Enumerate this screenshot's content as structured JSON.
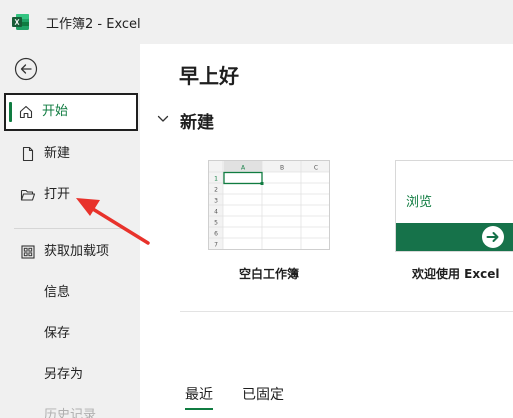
{
  "window": {
    "title": "工作簿2  -  Excel",
    "app_icon": "excel-icon"
  },
  "sidebar": {
    "back_icon": "back-arrow-icon",
    "items": [
      {
        "label": "开始",
        "icon": "home-icon",
        "active": true
      },
      {
        "label": "新建",
        "icon": "new-document-icon"
      },
      {
        "label": "打开",
        "icon": "open-folder-icon"
      },
      {
        "label": "获取加载项",
        "icon": "add-ins-icon"
      },
      {
        "label": "信息"
      },
      {
        "label": "保存"
      },
      {
        "label": "另存为"
      },
      {
        "label": "历史记录"
      }
    ]
  },
  "main": {
    "greeting": "早上好",
    "new_section": {
      "title": "新建",
      "templates": [
        {
          "label": "空白工作簿",
          "grid_columns": [
            "A",
            "B",
            "C"
          ],
          "grid_rows": [
            "1",
            "2",
            "3",
            "4",
            "5",
            "6",
            "7"
          ]
        },
        {
          "label": "欢迎使用 Excel",
          "link_text": "浏览"
        }
      ]
    },
    "tabs": [
      {
        "label": "最近",
        "active": true
      },
      {
        "label": "已固定"
      }
    ]
  },
  "colors": {
    "accent_green": "#107c41",
    "band_green": "#16724a",
    "sidebar_bg": "#f0f0f0",
    "annotation_red": "#e8322b"
  }
}
